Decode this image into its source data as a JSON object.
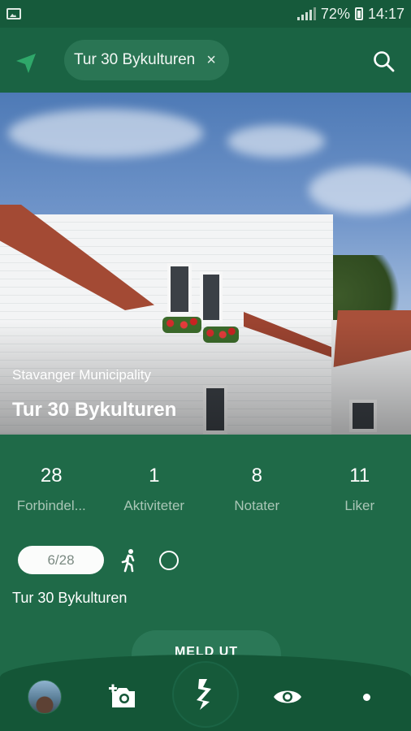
{
  "status_bar": {
    "battery": "72%",
    "time": "14:17"
  },
  "app_bar": {
    "chip_label": "Tur 30 Bykulturen",
    "chip_close": "×"
  },
  "hero": {
    "subtitle": "Stavanger Municipality",
    "title": "Tur 30 Bykulturen"
  },
  "stats": [
    {
      "value": "28",
      "label": "Forbindel..."
    },
    {
      "value": "1",
      "label": "Aktiviteter"
    },
    {
      "value": "8",
      "label": "Notater"
    },
    {
      "value": "11",
      "label": "Liker"
    }
  ],
  "progress": {
    "label": "6/28",
    "route_name": "Tur 30 Bykulturen"
  },
  "join_button": {
    "label": "MELD UT"
  },
  "icons": {
    "nav": "navigation-arrow-icon",
    "search": "search-icon",
    "walk": "walking-person-icon",
    "camera": "add-photo-icon",
    "logo": "app-logo-icon",
    "eye": "eye-icon",
    "dot": "dot-icon"
  }
}
